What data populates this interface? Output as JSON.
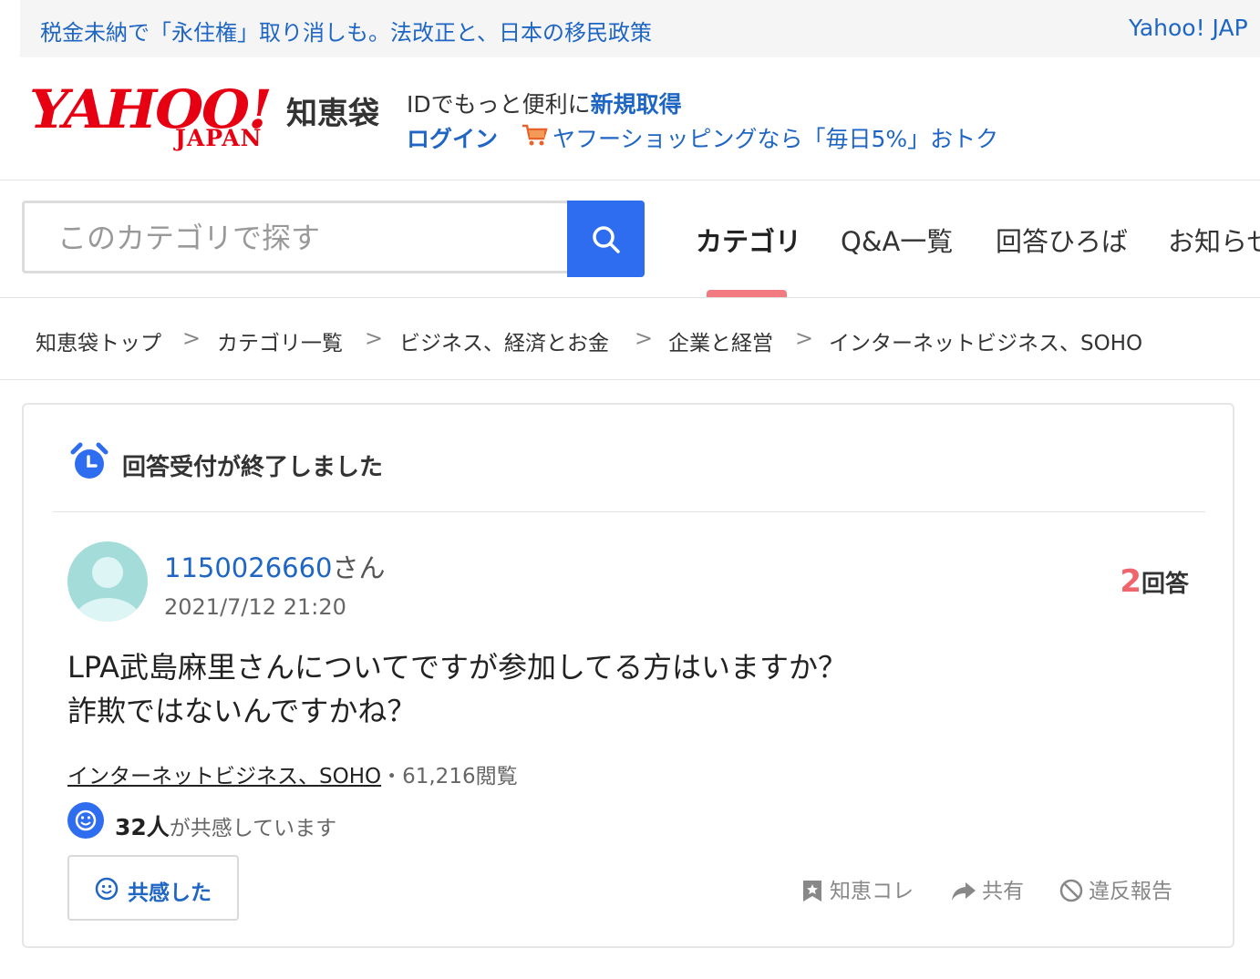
{
  "top_news": {
    "headline": "税金未納で「永住権」取り消しも。法改正と、日本の移民政策",
    "site_link": "Yahoo! JAP"
  },
  "header": {
    "logo_text": "YAHOO!",
    "logo_sub": "JAPAN",
    "service_name": "知恵袋",
    "id_text": "IDでもっと便利に",
    "register_link": "新規取得",
    "login_link": "ログイン",
    "promo_link": "ヤフーショッピングなら「毎日5%」おトク"
  },
  "search": {
    "placeholder": "このカテゴリで探す"
  },
  "tabs": [
    {
      "label": "カテゴリ",
      "active": true
    },
    {
      "label": "Q&A一覧",
      "active": false
    },
    {
      "label": "回答ひろば",
      "active": false
    },
    {
      "label": "お知らせ",
      "active": false
    }
  ],
  "breadcrumb": [
    "知恵袋トップ",
    "カテゴリ一覧",
    "ビジネス、経済とお金",
    "企業と経営",
    "インターネットビジネス、SOHO"
  ],
  "breadcrumb_sep": ">",
  "question": {
    "status": "回答受付が終了しました",
    "user": "1150026660",
    "user_suffix": "さん",
    "datetime": "2021/7/12 21:20",
    "answer_count": "2",
    "answer_label": "回答",
    "body_line1": "LPA武島麻里さんについてですが参加してる方はいますか？",
    "body_line2": "詐欺ではないんですかね？",
    "category": "インターネットビジネス、SOHO",
    "views": "・61,216閲覧",
    "empathy_count": "32人",
    "empathy_text": "が共感しています",
    "empathy_button": "共感した",
    "actions": {
      "save": "知恵コレ",
      "share": "共有",
      "report": "違反報告"
    }
  },
  "colors": {
    "link": "#1f66c4",
    "brand_red": "#e60012",
    "accent_pink": "#f0646c",
    "search_blue": "#2f6df0"
  }
}
